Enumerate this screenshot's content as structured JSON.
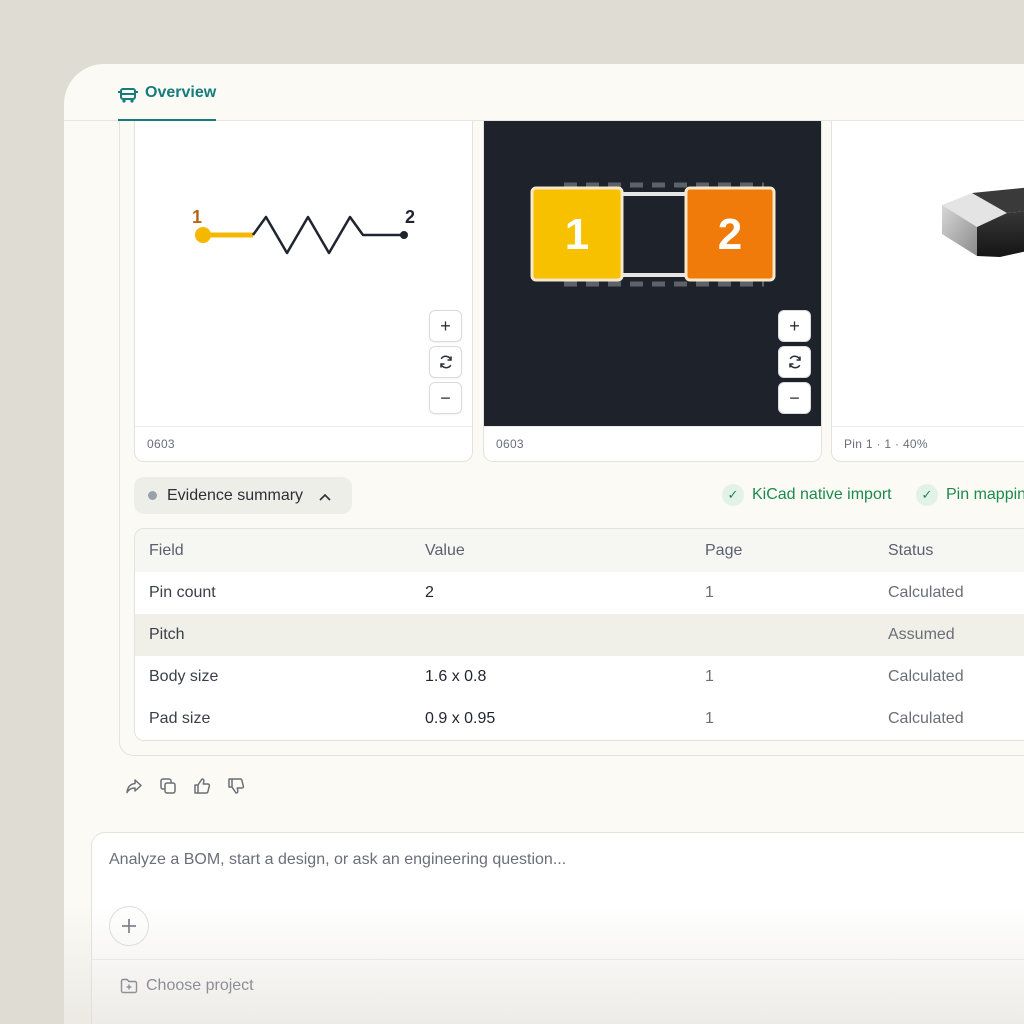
{
  "tab": {
    "label": "Overview",
    "icon": "bus-icon"
  },
  "panels": [
    {
      "kind": "schematic",
      "pin1": "1",
      "pin2": "2",
      "footer": "0603"
    },
    {
      "kind": "footprint",
      "pad1": "1",
      "pad2": "2",
      "footer": "0603"
    },
    {
      "kind": "3d-model",
      "footer": "Pin 1 · 1 · 40%"
    }
  ],
  "zoom": {
    "plus": "+",
    "minus": "−"
  },
  "evidence": {
    "label": "Evidence summary",
    "chips": [
      "KiCad native import",
      "Pin mapping"
    ]
  },
  "table": {
    "headers": [
      "Field",
      "Value",
      "Page",
      "Status"
    ],
    "rows": [
      {
        "field": "Pin count",
        "value": "2",
        "page": "1",
        "status": "Calculated"
      },
      {
        "field": "Pitch",
        "value": "",
        "page": "",
        "status": "Assumed"
      },
      {
        "field": "Body size",
        "value": "1.6 x 0.8",
        "page": "1",
        "status": "Calculated"
      },
      {
        "field": "Pad size",
        "value": "0.9 x 0.95",
        "page": "1",
        "status": "Calculated"
      }
    ]
  },
  "composer": {
    "placeholder": "Analyze a BOM, start a design, or ask an engineering question...",
    "project_label": "Choose project"
  },
  "colors": {
    "accent": "#157b7c",
    "pad1": "#f7c100",
    "pad2": "#f07a0a",
    "success": "#1c8a4d"
  }
}
